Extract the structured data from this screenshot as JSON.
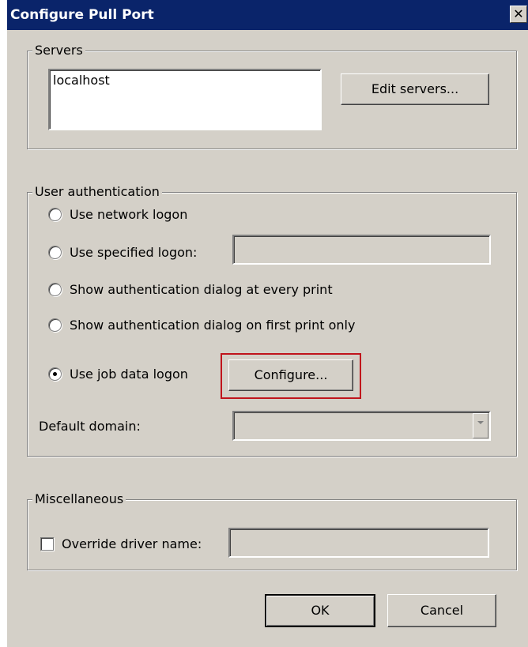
{
  "window": {
    "title": "Configure Pull Port",
    "close_glyph": "✕"
  },
  "servers": {
    "legend": "Servers",
    "list": [
      "localhost"
    ],
    "edit_button": "Edit servers..."
  },
  "auth": {
    "legend": "User authentication",
    "options": [
      {
        "label": "Use network logon",
        "selected": false
      },
      {
        "label": "Use specified logon:",
        "selected": false
      },
      {
        "label": "Show authentication dialog at every print",
        "selected": false
      },
      {
        "label": "Show authentication dialog on first print only",
        "selected": false
      },
      {
        "label": "Use job data logon",
        "selected": true
      }
    ],
    "specified_logon_value": "",
    "configure_button": "Configure...",
    "default_domain_label": "Default domain:",
    "default_domain_value": ""
  },
  "misc": {
    "legend": "Miscellaneous",
    "override_label": "Override driver name:",
    "override_checked": false,
    "override_value": ""
  },
  "footer": {
    "ok_label": "OK",
    "cancel_label": "Cancel"
  },
  "colors": {
    "titlebar": "#0a246a",
    "face": "#d4d0c8",
    "highlight": "#c0141c"
  }
}
